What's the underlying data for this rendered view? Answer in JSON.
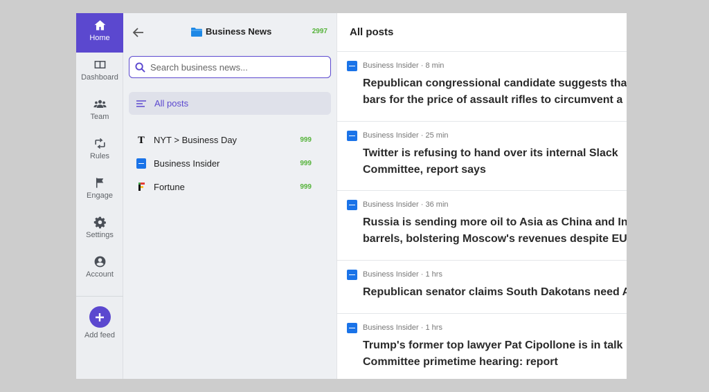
{
  "rail": {
    "items": [
      {
        "label": "Home",
        "icon": "home-icon"
      },
      {
        "label": "Dashboard",
        "icon": "dashboard-icon"
      },
      {
        "label": "Team",
        "icon": "team-icon"
      },
      {
        "label": "Rules",
        "icon": "rules-icon"
      },
      {
        "label": "Engage",
        "icon": "flag-icon"
      },
      {
        "label": "Settings",
        "icon": "gear-icon"
      },
      {
        "label": "Account",
        "icon": "account-icon"
      }
    ],
    "add_feed_label": "Add feed"
  },
  "panel": {
    "folder_name": "Business News",
    "total_count": "2997",
    "search_placeholder": "Search business news...",
    "all_posts_label": "All posts",
    "feeds": [
      {
        "name": "NYT > Business Day",
        "count": "999",
        "icon": "nyt-icon"
      },
      {
        "name": "Business Insider",
        "count": "999",
        "icon": "business-insider-icon"
      },
      {
        "name": "Fortune",
        "count": "999",
        "icon": "fortune-icon"
      }
    ]
  },
  "main": {
    "title": "All posts",
    "posts": [
      {
        "source": "Business Insider",
        "age": "8 min",
        "title_lines": [
          "Republican congressional candidate suggests tha",
          "bars for the price of assault rifles to circumvent a"
        ]
      },
      {
        "source": "Business Insider",
        "age": "25 min",
        "title_lines": [
          "Twitter is refusing to hand over its internal Slack",
          "Committee, report says"
        ]
      },
      {
        "source": "Business Insider",
        "age": "36 min",
        "title_lines": [
          "Russia is sending more oil to Asia as China and In",
          "barrels, bolstering Moscow's revenues despite EU"
        ]
      },
      {
        "source": "Business Insider",
        "age": "1 hrs",
        "title_lines": [
          "Republican senator claims South Dakotans need A"
        ]
      },
      {
        "source": "Business Insider",
        "age": "1 hrs",
        "title_lines": [
          "Trump's former top lawyer Pat Cipollone is in talk",
          "Committee primetime hearing: report"
        ]
      }
    ]
  },
  "colors": {
    "accent": "#5b48cf",
    "count_green": "#56b33b",
    "bi_blue": "#1a73e8"
  }
}
